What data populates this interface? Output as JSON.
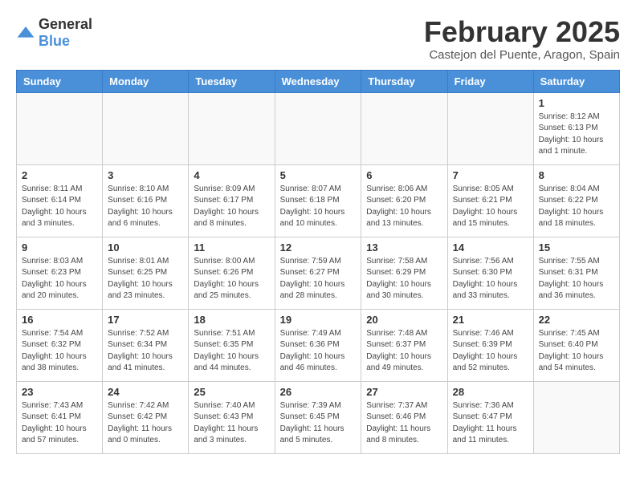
{
  "header": {
    "logo_general": "General",
    "logo_blue": "Blue",
    "month_title": "February 2025",
    "location": "Castejon del Puente, Aragon, Spain"
  },
  "weekdays": [
    "Sunday",
    "Monday",
    "Tuesday",
    "Wednesday",
    "Thursday",
    "Friday",
    "Saturday"
  ],
  "weeks": [
    [
      {
        "day": "",
        "info": ""
      },
      {
        "day": "",
        "info": ""
      },
      {
        "day": "",
        "info": ""
      },
      {
        "day": "",
        "info": ""
      },
      {
        "day": "",
        "info": ""
      },
      {
        "day": "",
        "info": ""
      },
      {
        "day": "1",
        "info": "Sunrise: 8:12 AM\nSunset: 6:13 PM\nDaylight: 10 hours\nand 1 minute."
      }
    ],
    [
      {
        "day": "2",
        "info": "Sunrise: 8:11 AM\nSunset: 6:14 PM\nDaylight: 10 hours\nand 3 minutes."
      },
      {
        "day": "3",
        "info": "Sunrise: 8:10 AM\nSunset: 6:16 PM\nDaylight: 10 hours\nand 6 minutes."
      },
      {
        "day": "4",
        "info": "Sunrise: 8:09 AM\nSunset: 6:17 PM\nDaylight: 10 hours\nand 8 minutes."
      },
      {
        "day": "5",
        "info": "Sunrise: 8:07 AM\nSunset: 6:18 PM\nDaylight: 10 hours\nand 10 minutes."
      },
      {
        "day": "6",
        "info": "Sunrise: 8:06 AM\nSunset: 6:20 PM\nDaylight: 10 hours\nand 13 minutes."
      },
      {
        "day": "7",
        "info": "Sunrise: 8:05 AM\nSunset: 6:21 PM\nDaylight: 10 hours\nand 15 minutes."
      },
      {
        "day": "8",
        "info": "Sunrise: 8:04 AM\nSunset: 6:22 PM\nDaylight: 10 hours\nand 18 minutes."
      }
    ],
    [
      {
        "day": "9",
        "info": "Sunrise: 8:03 AM\nSunset: 6:23 PM\nDaylight: 10 hours\nand 20 minutes."
      },
      {
        "day": "10",
        "info": "Sunrise: 8:01 AM\nSunset: 6:25 PM\nDaylight: 10 hours\nand 23 minutes."
      },
      {
        "day": "11",
        "info": "Sunrise: 8:00 AM\nSunset: 6:26 PM\nDaylight: 10 hours\nand 25 minutes."
      },
      {
        "day": "12",
        "info": "Sunrise: 7:59 AM\nSunset: 6:27 PM\nDaylight: 10 hours\nand 28 minutes."
      },
      {
        "day": "13",
        "info": "Sunrise: 7:58 AM\nSunset: 6:29 PM\nDaylight: 10 hours\nand 30 minutes."
      },
      {
        "day": "14",
        "info": "Sunrise: 7:56 AM\nSunset: 6:30 PM\nDaylight: 10 hours\nand 33 minutes."
      },
      {
        "day": "15",
        "info": "Sunrise: 7:55 AM\nSunset: 6:31 PM\nDaylight: 10 hours\nand 36 minutes."
      }
    ],
    [
      {
        "day": "16",
        "info": "Sunrise: 7:54 AM\nSunset: 6:32 PM\nDaylight: 10 hours\nand 38 minutes."
      },
      {
        "day": "17",
        "info": "Sunrise: 7:52 AM\nSunset: 6:34 PM\nDaylight: 10 hours\nand 41 minutes."
      },
      {
        "day": "18",
        "info": "Sunrise: 7:51 AM\nSunset: 6:35 PM\nDaylight: 10 hours\nand 44 minutes."
      },
      {
        "day": "19",
        "info": "Sunrise: 7:49 AM\nSunset: 6:36 PM\nDaylight: 10 hours\nand 46 minutes."
      },
      {
        "day": "20",
        "info": "Sunrise: 7:48 AM\nSunset: 6:37 PM\nDaylight: 10 hours\nand 49 minutes."
      },
      {
        "day": "21",
        "info": "Sunrise: 7:46 AM\nSunset: 6:39 PM\nDaylight: 10 hours\nand 52 minutes."
      },
      {
        "day": "22",
        "info": "Sunrise: 7:45 AM\nSunset: 6:40 PM\nDaylight: 10 hours\nand 54 minutes."
      }
    ],
    [
      {
        "day": "23",
        "info": "Sunrise: 7:43 AM\nSunset: 6:41 PM\nDaylight: 10 hours\nand 57 minutes."
      },
      {
        "day": "24",
        "info": "Sunrise: 7:42 AM\nSunset: 6:42 PM\nDaylight: 11 hours\nand 0 minutes."
      },
      {
        "day": "25",
        "info": "Sunrise: 7:40 AM\nSunset: 6:43 PM\nDaylight: 11 hours\nand 3 minutes."
      },
      {
        "day": "26",
        "info": "Sunrise: 7:39 AM\nSunset: 6:45 PM\nDaylight: 11 hours\nand 5 minutes."
      },
      {
        "day": "27",
        "info": "Sunrise: 7:37 AM\nSunset: 6:46 PM\nDaylight: 11 hours\nand 8 minutes."
      },
      {
        "day": "28",
        "info": "Sunrise: 7:36 AM\nSunset: 6:47 PM\nDaylight: 11 hours\nand 11 minutes."
      },
      {
        "day": "",
        "info": ""
      }
    ]
  ]
}
